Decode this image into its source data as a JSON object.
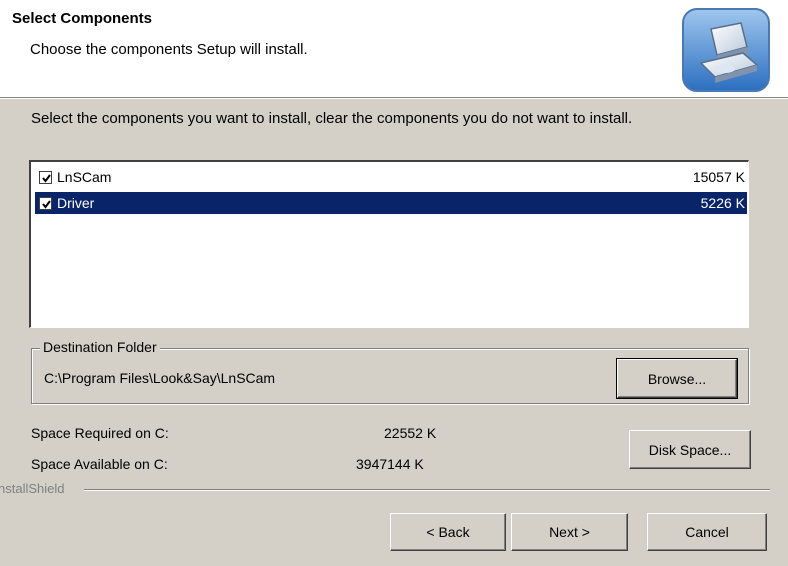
{
  "header": {
    "title": "Select Components",
    "subtitle": "Choose the components Setup will install.",
    "icon": "setup-computer-icon"
  },
  "instruction": "Select the components you want to install, clear the components you do not want to install.",
  "components": [
    {
      "name": "LnSCam",
      "size": "15057 K",
      "checked": true,
      "selected": false
    },
    {
      "name": "Driver",
      "size": "5226 K",
      "checked": true,
      "selected": true
    }
  ],
  "destination": {
    "legend": "Destination Folder",
    "path": "C:\\Program Files\\Look&Say\\LnSCam",
    "browse_label": "Browse..."
  },
  "space": {
    "required_label": "Space Required on C:",
    "required_value": "22552 K",
    "available_label": "Space Available on C:",
    "available_value": "3947144 K",
    "disk_space_label": "Disk Space..."
  },
  "brand": "nstallShield",
  "footer": {
    "back_label": "< Back",
    "next_label": "Next >",
    "cancel_label": "Cancel"
  },
  "colors": {
    "selection": "#0a246a",
    "dialog_bg": "#d4d0c8"
  }
}
